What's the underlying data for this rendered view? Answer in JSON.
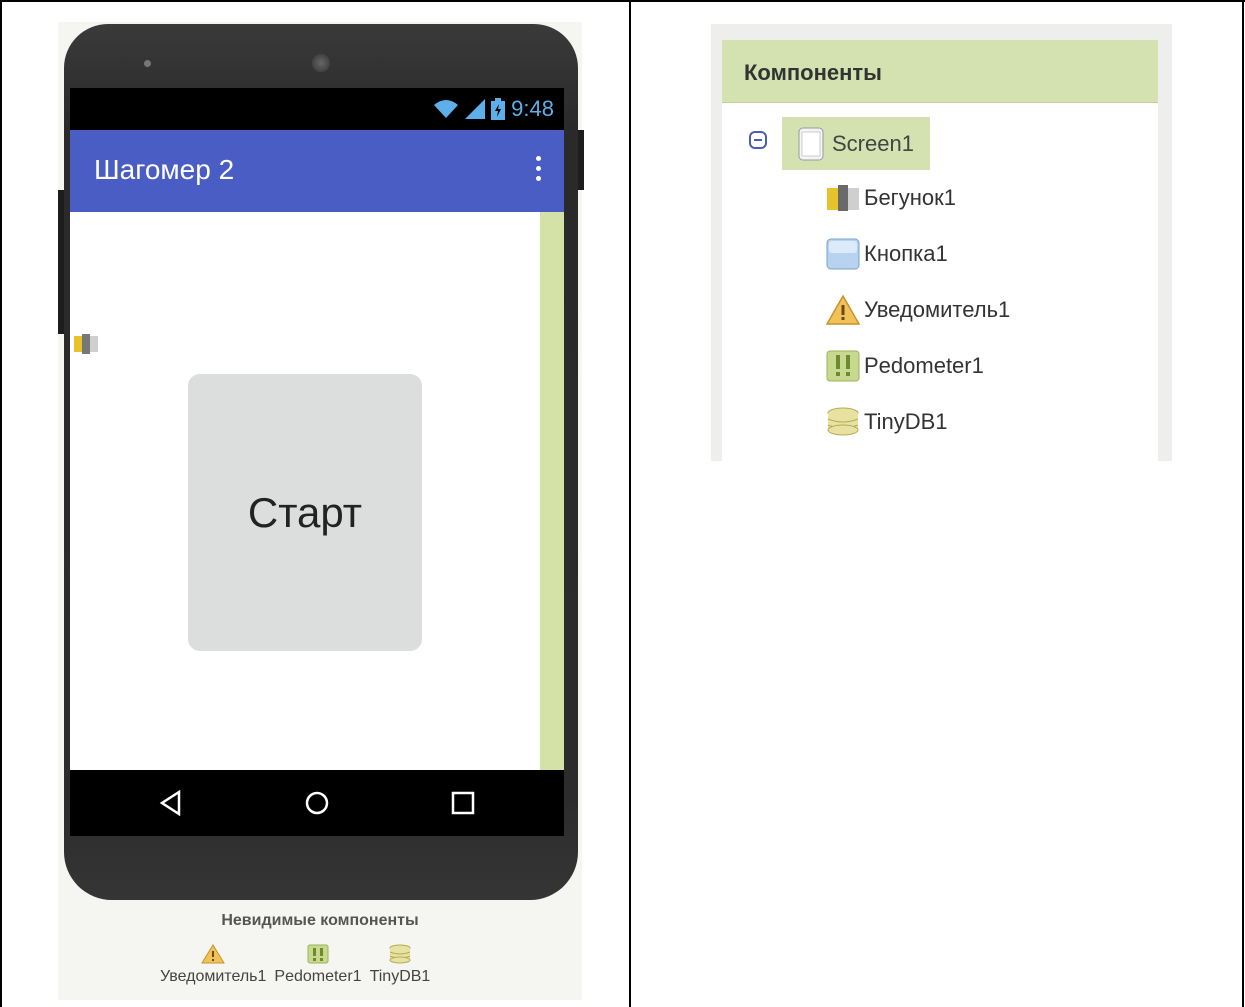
{
  "phone": {
    "status_time": "9:48",
    "app_title": "Шагомер 2",
    "start_button_label": "Старт",
    "invisible_title": "Невидимые компоненты",
    "invisible_items": [
      {
        "label": "Уведомитель1",
        "icon": "warning-icon"
      },
      {
        "label": "Pedometer1",
        "icon": "pedometer-icon"
      },
      {
        "label": "TinyDB1",
        "icon": "database-icon"
      }
    ]
  },
  "components_panel": {
    "title": "Компоненты",
    "root": {
      "label": "Screen1",
      "icon": "screen-icon"
    },
    "children": [
      {
        "label": "Бегунок1",
        "icon": "slider-icon"
      },
      {
        "label": "Кнопка1",
        "icon": "button-icon"
      },
      {
        "label": "Уведомитель1",
        "icon": "warning-icon"
      },
      {
        "label": "Pedometer1",
        "icon": "pedometer-icon"
      },
      {
        "label": "TinyDB1",
        "icon": "database-icon"
      }
    ]
  },
  "colors": {
    "app_bar": "#4a5dc4",
    "panel_header": "#d3e2b0",
    "status_time": "#5dafe9"
  }
}
